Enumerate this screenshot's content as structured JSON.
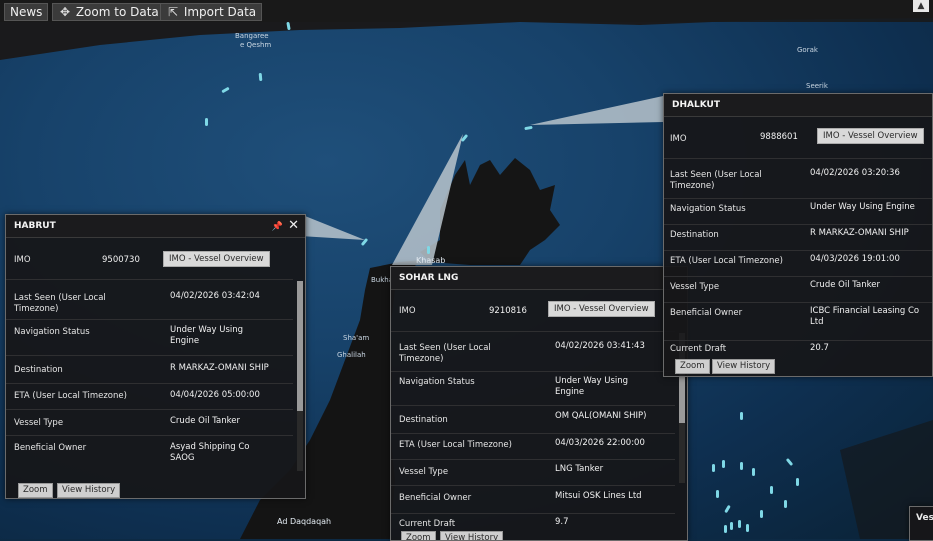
{
  "toolbar": {
    "news_label": "News",
    "zoom_label": "Zoom to Data",
    "import_label": "Import Data",
    "zoom_icon": "crosshair-icon",
    "import_icon": "import-icon"
  },
  "map": {
    "places": [
      "Khasab",
      "Bukha",
      "Sha'am",
      "Ghalilah",
      "Ad Daqdaqah"
    ],
    "small_places": [
      "Bangaree",
      "e Qeshm",
      "Qeshm",
      "Gorak",
      "Seerik"
    ]
  },
  "field_labels": {
    "imo": "IMO",
    "last_seen": "Last Seen (User Local Timezone)",
    "nav_status": "Navigation Status",
    "destination": "Destination",
    "eta": "ETA (User Local Timezone)",
    "vessel_type": "Vessel Type",
    "owner": "Beneficial Owner",
    "draft": "Current Draft"
  },
  "vessel_overview_label": "IMO - Vessel Overview",
  "zoom_button_label": "Zoom",
  "history_button_label": "View History",
  "panels": {
    "habrut": {
      "title": "HABRUT",
      "imo": "9500730",
      "last_seen": "04/02/2026 03:42:04",
      "nav_status": "Under Way Using Engine",
      "destination": "R MARKAZ-OMANI SHIP",
      "eta": "04/04/2026 05:00:00",
      "vessel_type": "Crude Oil Tanker",
      "owner": "Asyad Shipping Co SAOG"
    },
    "sohar": {
      "title": "SOHAR LNG",
      "imo": "9210816",
      "last_seen": "04/02/2026 03:41:43",
      "nav_status": "Under Way Using Engine",
      "destination": "OM QAL(OMANI SHIP)",
      "eta": "04/03/2026 22:00:00",
      "vessel_type": "LNG Tanker",
      "owner": "Mitsui OSK Lines Ltd",
      "draft": "9.7"
    },
    "dhalkut": {
      "title": "DHALKUT",
      "imo": "9888601",
      "last_seen": "04/02/2026 03:20:36",
      "nav_status": "Under Way Using Engine",
      "destination": "R MARKAZ-OMANI SHIP",
      "eta": "04/03/2026 19:01:00",
      "vessel_type": "Crude Oil Tanker",
      "owner": "ICBC Financial Leasing Co Ltd",
      "draft": "20.7"
    }
  },
  "edge_panel_title": "Ves",
  "colors": {
    "sea": "#17426a",
    "land": "#151515",
    "vessel": "#7fd8e6",
    "panel_bg": "#161618",
    "pin": "#e04848"
  }
}
